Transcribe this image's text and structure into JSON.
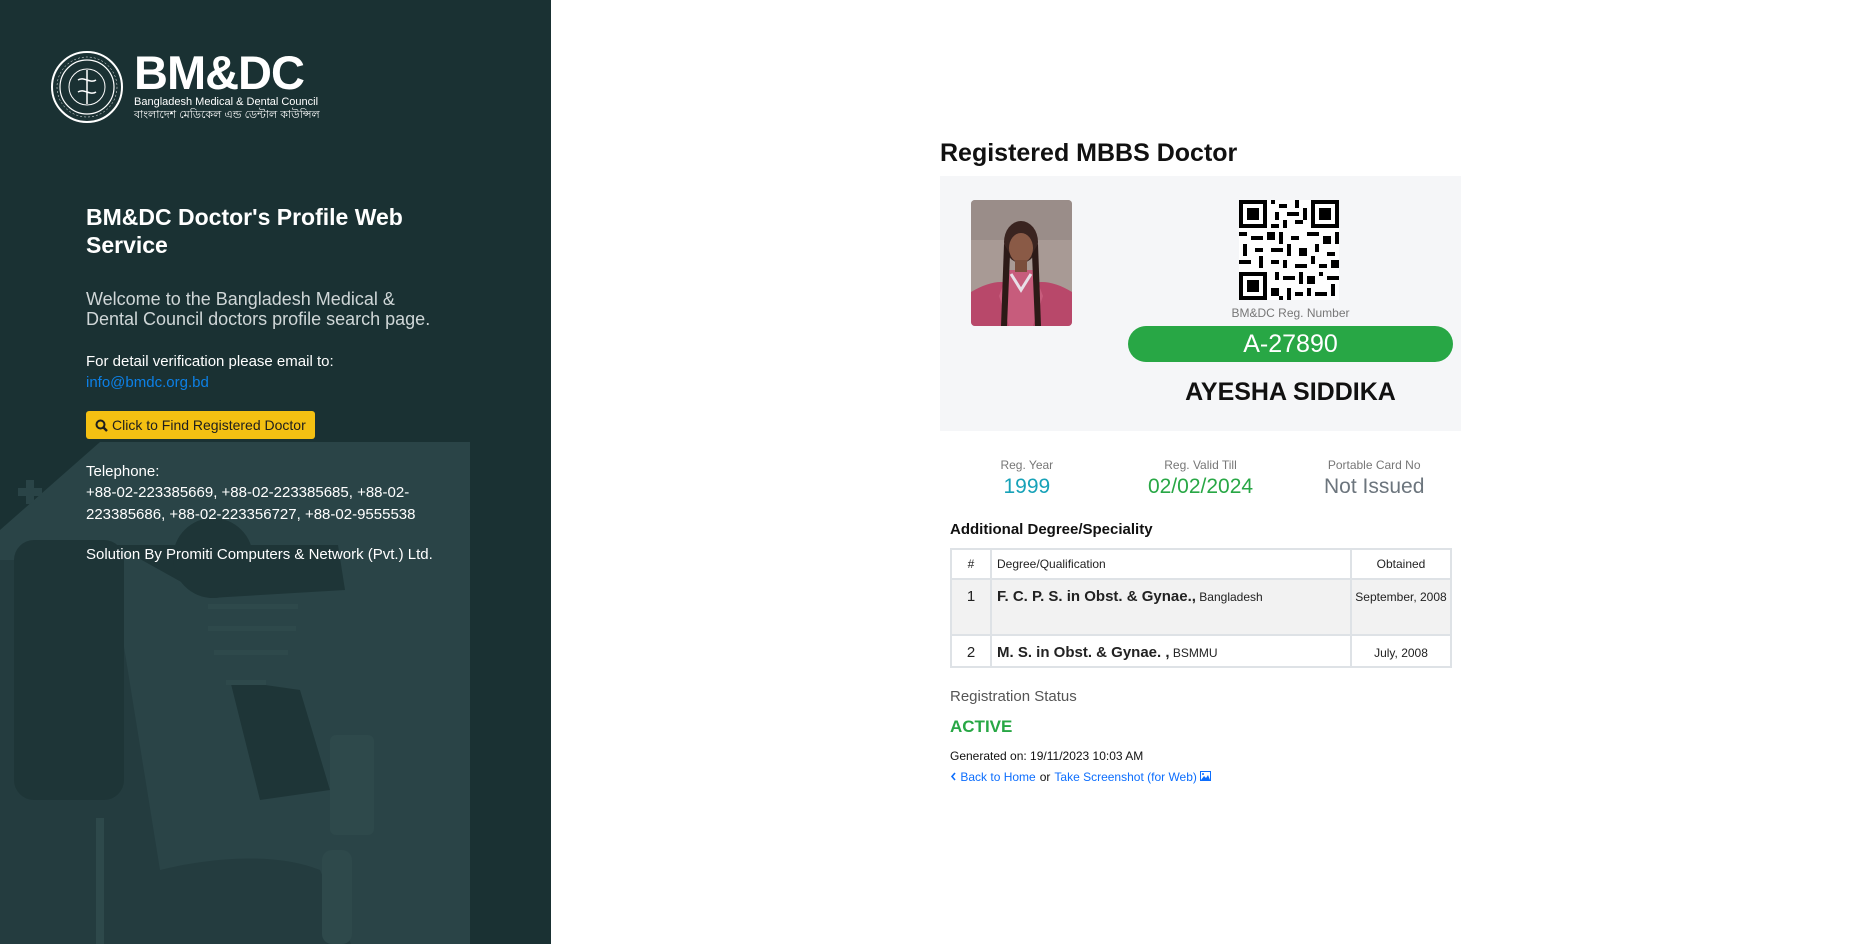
{
  "sidebar": {
    "logo": {
      "wordmark": "BM&DC",
      "subtitle_en": "Bangladesh Medical & Dental Council",
      "subtitle_bn": "বাংলাদেশ মেডিকেল এন্ড ডেন্টাল কাউন্সিল"
    },
    "title": "BM&DC Doctor's Profile Web Service",
    "welcome": "Welcome to the Bangladesh Medical & Dental Council doctors profile search page.",
    "email_label": "For detail verification please email to:",
    "email": "info@bmdc.org.bd",
    "find_button": "Click to Find Registered Doctor",
    "telephone_label": "Telephone:",
    "telephone_numbers": "+88-02-223385669, +88-02-223385685, +88-02-223385686, +88-02-223356727, +88-02-9555538",
    "solution": "Solution By Promiti Computers & Network (Pvt.) Ltd."
  },
  "profile": {
    "heading": "Registered MBBS Doctor",
    "reg_number_label": "BM&DC Reg. Number",
    "reg_number": "A-27890",
    "doctor_name": "AYESHA SIDDIKA",
    "stats": [
      {
        "label": "Reg. Year",
        "value": "1999",
        "color": "#17a2b8"
      },
      {
        "label": "Reg. Valid Till",
        "value": "02/02/2024",
        "color": "#28a745"
      },
      {
        "label": "Portable Card No",
        "value": "Not Issued",
        "color": "#6c757d"
      }
    ],
    "degrees_heading": "Additional Degree/Speciality",
    "table": {
      "headers": [
        "#",
        "Degree/Qualification",
        "Obtained"
      ],
      "rows": [
        {
          "num": "1",
          "degree": "F. C. P. S. in Obst. & Gynae.,",
          "institute": "Bangladesh",
          "obtained": "September, 2008"
        },
        {
          "num": "2",
          "degree": "M. S. in Obst. & Gynae. ,",
          "institute": "BSMMU",
          "obtained": "July, 2008"
        }
      ]
    },
    "status_label": "Registration Status",
    "status": "ACTIVE",
    "generated": "Generated on: 19/11/2023 10:03 AM",
    "back_link": "Back to Home",
    "or_text": "or",
    "screenshot_link": "Take Screenshot (for Web)"
  },
  "colors": {
    "sidebar_bg": "#1a3133",
    "accent_yellow": "#f4c012",
    "success": "#28a745",
    "info": "#17a2b8",
    "link": "#0d6efd"
  }
}
